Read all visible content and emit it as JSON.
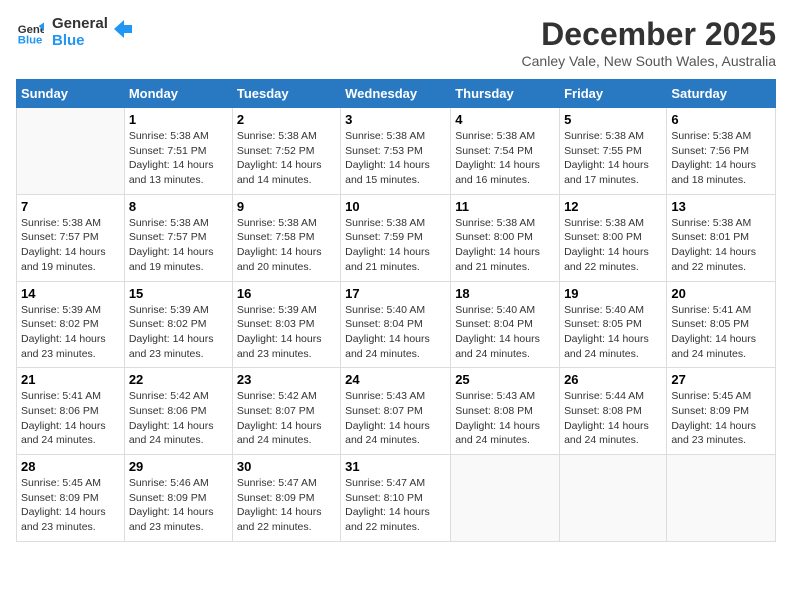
{
  "logo": {
    "line1": "General",
    "line2": "Blue"
  },
  "title": "December 2025",
  "location": "Canley Vale, New South Wales, Australia",
  "days_of_week": [
    "Sunday",
    "Monday",
    "Tuesday",
    "Wednesday",
    "Thursday",
    "Friday",
    "Saturday"
  ],
  "weeks": [
    [
      {
        "day": "",
        "content": ""
      },
      {
        "day": "1",
        "content": "Sunrise: 5:38 AM\nSunset: 7:51 PM\nDaylight: 14 hours\nand 13 minutes."
      },
      {
        "day": "2",
        "content": "Sunrise: 5:38 AM\nSunset: 7:52 PM\nDaylight: 14 hours\nand 14 minutes."
      },
      {
        "day": "3",
        "content": "Sunrise: 5:38 AM\nSunset: 7:53 PM\nDaylight: 14 hours\nand 15 minutes."
      },
      {
        "day": "4",
        "content": "Sunrise: 5:38 AM\nSunset: 7:54 PM\nDaylight: 14 hours\nand 16 minutes."
      },
      {
        "day": "5",
        "content": "Sunrise: 5:38 AM\nSunset: 7:55 PM\nDaylight: 14 hours\nand 17 minutes."
      },
      {
        "day": "6",
        "content": "Sunrise: 5:38 AM\nSunset: 7:56 PM\nDaylight: 14 hours\nand 18 minutes."
      }
    ],
    [
      {
        "day": "7",
        "content": "Sunrise: 5:38 AM\nSunset: 7:57 PM\nDaylight: 14 hours\nand 19 minutes."
      },
      {
        "day": "8",
        "content": "Sunrise: 5:38 AM\nSunset: 7:57 PM\nDaylight: 14 hours\nand 19 minutes."
      },
      {
        "day": "9",
        "content": "Sunrise: 5:38 AM\nSunset: 7:58 PM\nDaylight: 14 hours\nand 20 minutes."
      },
      {
        "day": "10",
        "content": "Sunrise: 5:38 AM\nSunset: 7:59 PM\nDaylight: 14 hours\nand 21 minutes."
      },
      {
        "day": "11",
        "content": "Sunrise: 5:38 AM\nSunset: 8:00 PM\nDaylight: 14 hours\nand 21 minutes."
      },
      {
        "day": "12",
        "content": "Sunrise: 5:38 AM\nSunset: 8:00 PM\nDaylight: 14 hours\nand 22 minutes."
      },
      {
        "day": "13",
        "content": "Sunrise: 5:38 AM\nSunset: 8:01 PM\nDaylight: 14 hours\nand 22 minutes."
      }
    ],
    [
      {
        "day": "14",
        "content": "Sunrise: 5:39 AM\nSunset: 8:02 PM\nDaylight: 14 hours\nand 23 minutes."
      },
      {
        "day": "15",
        "content": "Sunrise: 5:39 AM\nSunset: 8:02 PM\nDaylight: 14 hours\nand 23 minutes."
      },
      {
        "day": "16",
        "content": "Sunrise: 5:39 AM\nSunset: 8:03 PM\nDaylight: 14 hours\nand 23 minutes."
      },
      {
        "day": "17",
        "content": "Sunrise: 5:40 AM\nSunset: 8:04 PM\nDaylight: 14 hours\nand 24 minutes."
      },
      {
        "day": "18",
        "content": "Sunrise: 5:40 AM\nSunset: 8:04 PM\nDaylight: 14 hours\nand 24 minutes."
      },
      {
        "day": "19",
        "content": "Sunrise: 5:40 AM\nSunset: 8:05 PM\nDaylight: 14 hours\nand 24 minutes."
      },
      {
        "day": "20",
        "content": "Sunrise: 5:41 AM\nSunset: 8:05 PM\nDaylight: 14 hours\nand 24 minutes."
      }
    ],
    [
      {
        "day": "21",
        "content": "Sunrise: 5:41 AM\nSunset: 8:06 PM\nDaylight: 14 hours\nand 24 minutes."
      },
      {
        "day": "22",
        "content": "Sunrise: 5:42 AM\nSunset: 8:06 PM\nDaylight: 14 hours\nand 24 minutes."
      },
      {
        "day": "23",
        "content": "Sunrise: 5:42 AM\nSunset: 8:07 PM\nDaylight: 14 hours\nand 24 minutes."
      },
      {
        "day": "24",
        "content": "Sunrise: 5:43 AM\nSunset: 8:07 PM\nDaylight: 14 hours\nand 24 minutes."
      },
      {
        "day": "25",
        "content": "Sunrise: 5:43 AM\nSunset: 8:08 PM\nDaylight: 14 hours\nand 24 minutes."
      },
      {
        "day": "26",
        "content": "Sunrise: 5:44 AM\nSunset: 8:08 PM\nDaylight: 14 hours\nand 24 minutes."
      },
      {
        "day": "27",
        "content": "Sunrise: 5:45 AM\nSunset: 8:09 PM\nDaylight: 14 hours\nand 23 minutes."
      }
    ],
    [
      {
        "day": "28",
        "content": "Sunrise: 5:45 AM\nSunset: 8:09 PM\nDaylight: 14 hours\nand 23 minutes."
      },
      {
        "day": "29",
        "content": "Sunrise: 5:46 AM\nSunset: 8:09 PM\nDaylight: 14 hours\nand 23 minutes."
      },
      {
        "day": "30",
        "content": "Sunrise: 5:47 AM\nSunset: 8:09 PM\nDaylight: 14 hours\nand 22 minutes."
      },
      {
        "day": "31",
        "content": "Sunrise: 5:47 AM\nSunset: 8:10 PM\nDaylight: 14 hours\nand 22 minutes."
      },
      {
        "day": "",
        "content": ""
      },
      {
        "day": "",
        "content": ""
      },
      {
        "day": "",
        "content": ""
      }
    ]
  ]
}
